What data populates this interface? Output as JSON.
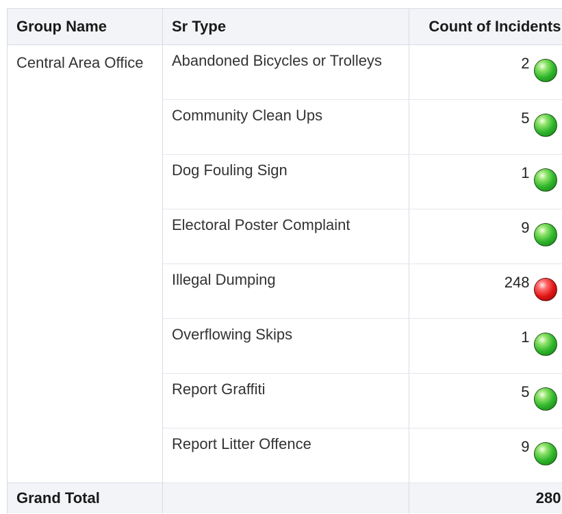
{
  "table": {
    "headers": {
      "group_name": "Group Name",
      "sr_type": "Sr Type",
      "count": "Count of Incidents"
    },
    "group": "Central Area Office",
    "rows": [
      {
        "sr_type": "Abandoned Bicycles or Trolleys",
        "count": "2",
        "status": "green"
      },
      {
        "sr_type": "Community Clean Ups",
        "count": "5",
        "status": "green"
      },
      {
        "sr_type": "Dog Fouling Sign",
        "count": "1",
        "status": "green"
      },
      {
        "sr_type": "Electoral Poster Complaint",
        "count": "9",
        "status": "green"
      },
      {
        "sr_type": "Illegal Dumping",
        "count": "248",
        "status": "red"
      },
      {
        "sr_type": "Overflowing Skips",
        "count": "1",
        "status": "green"
      },
      {
        "sr_type": "Report Graffiti",
        "count": "5",
        "status": "green"
      },
      {
        "sr_type": "Report Litter Offence",
        "count": "9",
        "status": "green"
      }
    ],
    "grand_total": {
      "label": "Grand Total",
      "value": "280"
    }
  },
  "colors": {
    "status_green": "#2fb52b",
    "status_red": "#e01616",
    "header_bg": "#f2f4f7",
    "border": "#d6dbe3"
  },
  "icons": {
    "green": "green-status-ball-icon",
    "red": "red-status-ball-icon"
  }
}
